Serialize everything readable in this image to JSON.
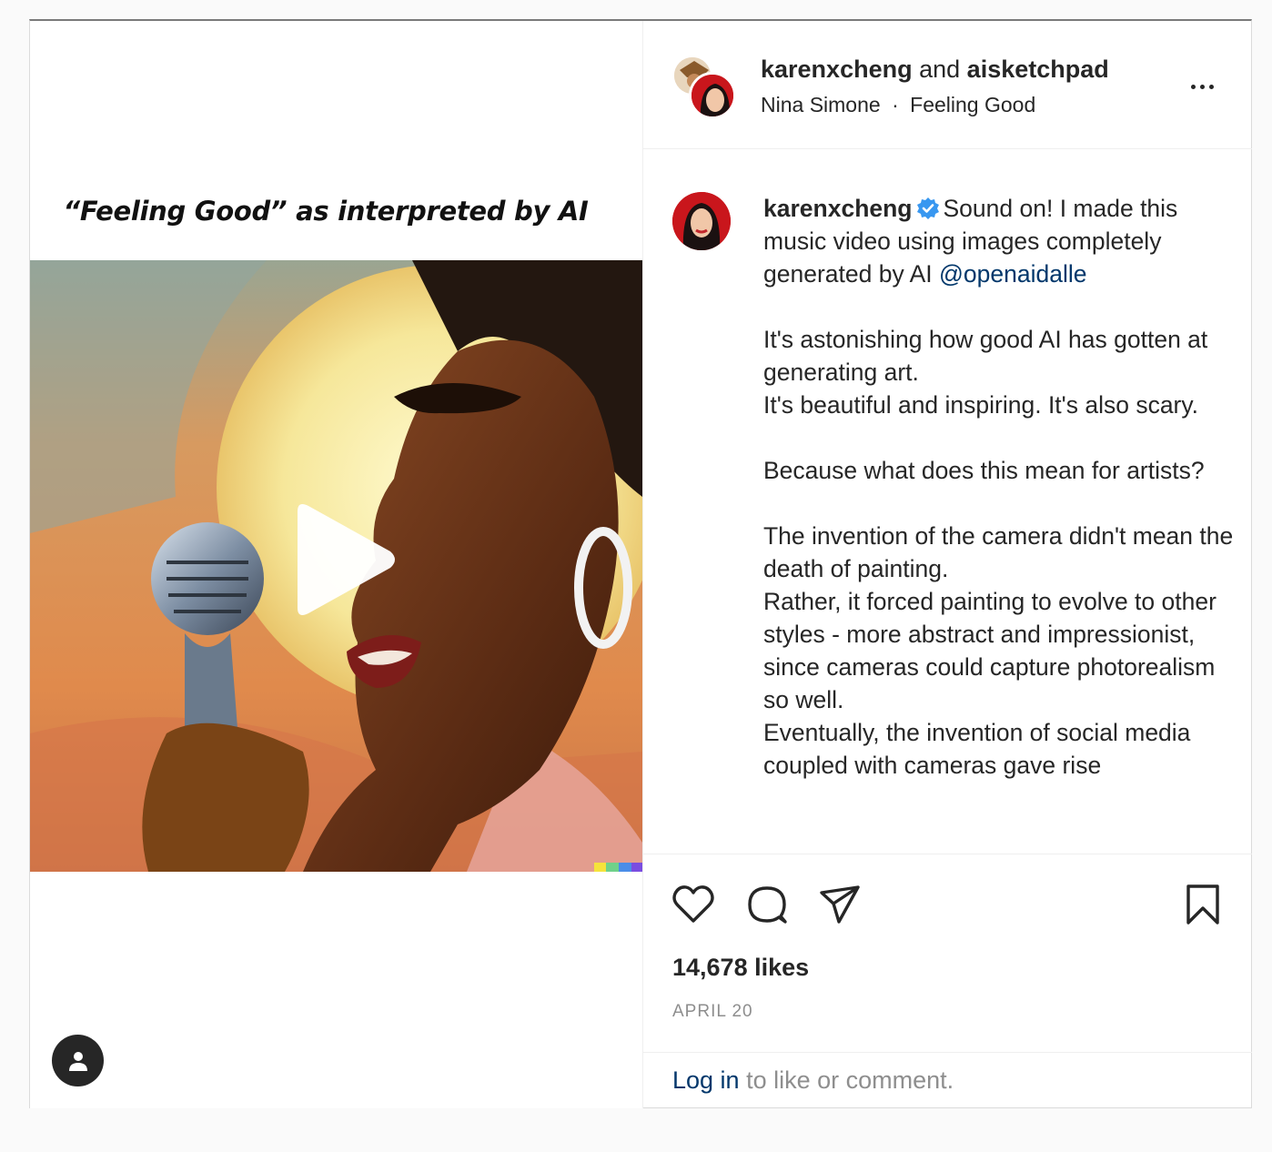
{
  "media": {
    "title": "“Feeling Good” as interpreted by AI",
    "play_icon": "play-icon",
    "user_icon": "person-icon"
  },
  "header": {
    "user1": "karenxcheng",
    "joiner": "and",
    "user2": "aisketchpad",
    "artist": "Nina Simone",
    "separator": "·",
    "song": "Feeling Good",
    "more_icon": "more-options-icon"
  },
  "caption": {
    "username": "karenxcheng",
    "lead": "Sound on! I made this music video using images completely generated by AI",
    "mention": "@openaidalle",
    "p1": "It's astonishing how good AI has gotten at generating art.\nIt's beautiful and inspiring. It's also scary.",
    "p2": "Because what does this mean for artists?",
    "p3": "The invention of the camera didn't mean the death of painting.\nRather, it forced painting to evolve to other styles - more abstract and impressionist, since cameras could capture photorealism so well.\nEventually, the invention of social media coupled with cameras gave rise"
  },
  "actions": {
    "likes": "14,678 likes",
    "date": "APRIL 20",
    "icons": [
      "heart-icon",
      "comment-icon",
      "share-icon",
      "bookmark-icon"
    ]
  },
  "login": {
    "link": "Log in",
    "rest": " to like or comment."
  },
  "colors": {
    "link": "#00376b",
    "verified": "#3897f0",
    "muted": "#8e8e8e",
    "border": "#dbdbdb"
  }
}
